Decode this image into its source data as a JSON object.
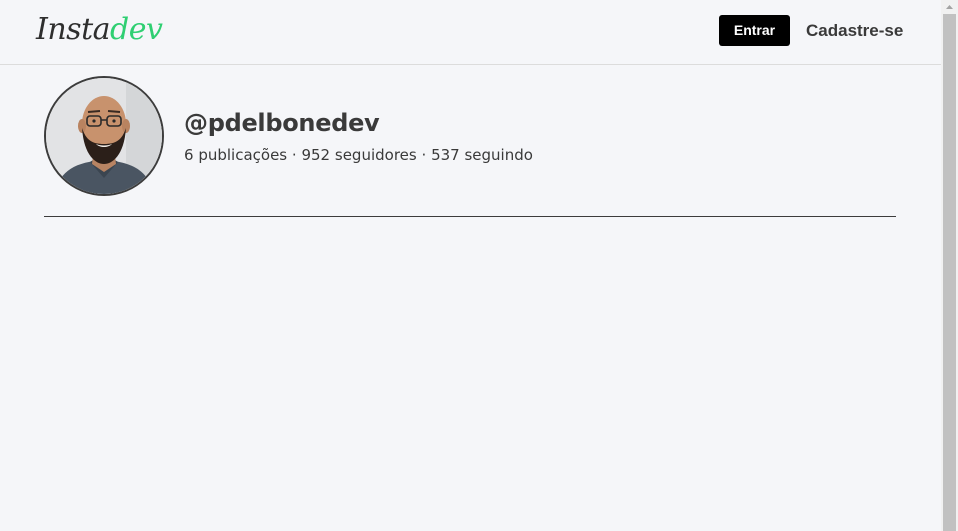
{
  "header": {
    "logo_part1": "Insta",
    "logo_part2": "dev",
    "login_label": "Entrar",
    "signup_label": "Cadastre-se"
  },
  "profile": {
    "username": "@pdelbonedev",
    "posts_count": "6",
    "posts_label": "publicações",
    "followers_count": "952",
    "followers_label": "seguidores",
    "following_count": "537",
    "following_label": "seguindo",
    "separator": "·"
  },
  "colors": {
    "accent": "#2fcf72",
    "button_bg": "#000000",
    "page_bg": "#f5f6f9",
    "text": "#3a3a3a"
  }
}
